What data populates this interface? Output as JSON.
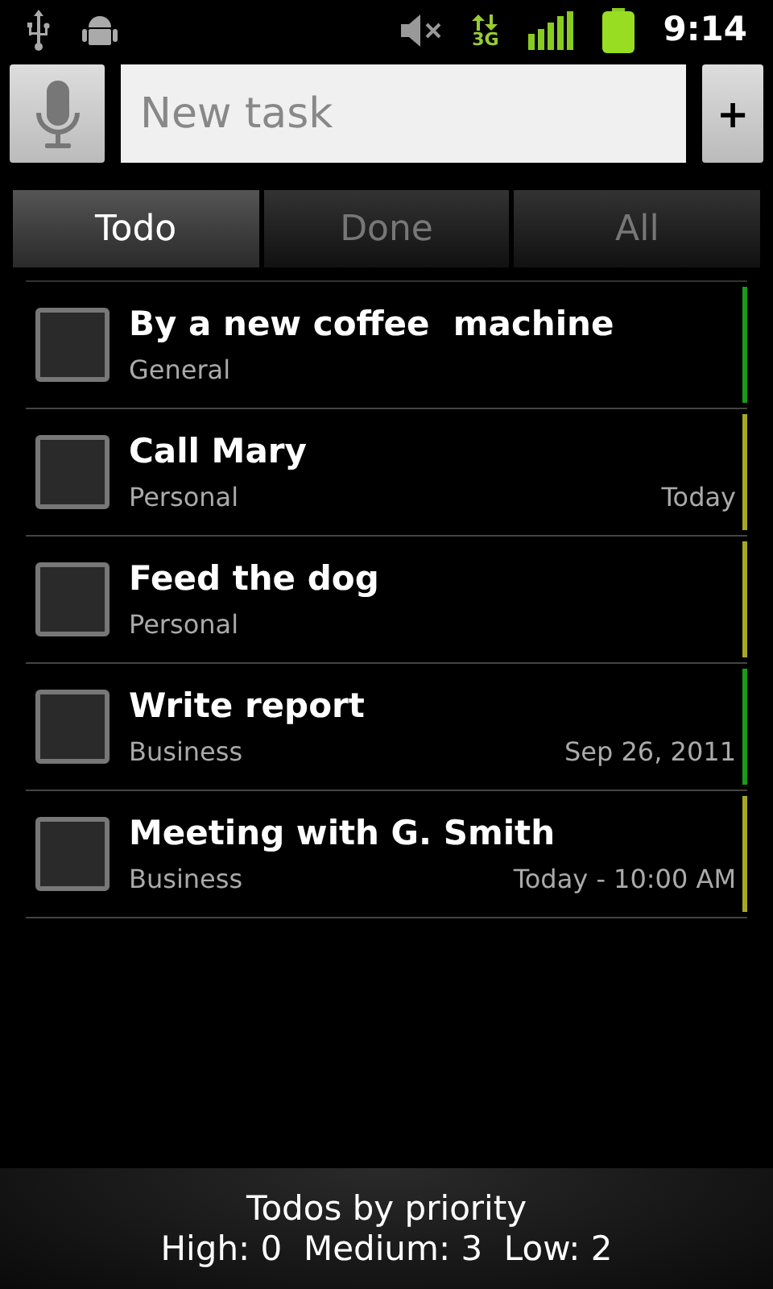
{
  "status_bar": {
    "network": "3G",
    "time": "9:14"
  },
  "new_task": {
    "placeholder": "New task",
    "add_label": "+"
  },
  "tabs": [
    {
      "label": "Todo",
      "selected": true
    },
    {
      "label": "Done",
      "selected": false
    },
    {
      "label": "All",
      "selected": false
    }
  ],
  "tasks": [
    {
      "title": "By a new coffee  machine",
      "category": "General",
      "checked": false,
      "color": "#1a9a1a"
    },
    {
      "title": "Call Mary",
      "category": "Personal",
      "due": "Today",
      "checked": false,
      "color": "#a8a820"
    },
    {
      "title": "Feed the dog",
      "category": "Personal",
      "checked": false,
      "color": "#a8a820"
    },
    {
      "title": "Write report",
      "category": "Business",
      "due": "Sep 26, 2011",
      "checked": false,
      "color": "#1a9a1a"
    },
    {
      "title": "Meeting with G. Smith",
      "category": "Business",
      "due": "Today - 10:00 AM",
      "checked": false,
      "color": "#a8a820"
    }
  ],
  "footer": {
    "title": "Todos by priority",
    "summary": "High: 0  Medium: 3  Low: 2"
  }
}
